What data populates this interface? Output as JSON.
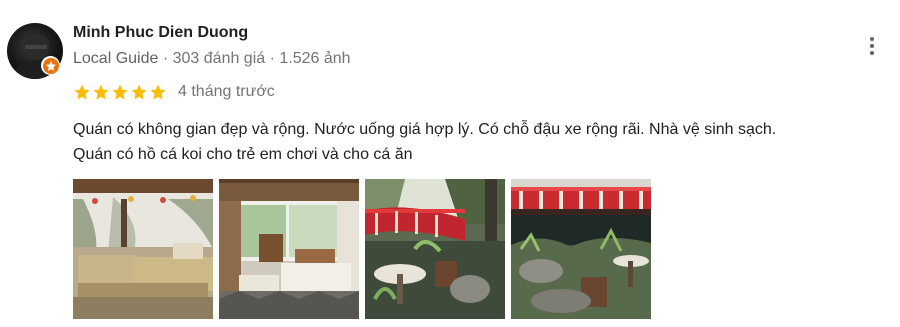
{
  "reviewer": {
    "name": "Minh Phuc Dien Duong",
    "badge": "Local Guide",
    "separator": "·",
    "reviews": "303 đánh giá",
    "photos": "1.526 ảnh",
    "avatar_icon": "profile-photo",
    "badge_icon": "local-guide-star-badge"
  },
  "rating": {
    "stars": 5,
    "max_stars": 5,
    "star_color": "#fbbc04",
    "time": "4 tháng trước"
  },
  "review": {
    "line1": "Quán có không gian đẹp và rộng. Nước uống giá hợp lý. Có chỗ đậu xe rộng rãi. Nhà vệ sinh sạch.",
    "line2": "Quán có hồ cá koi cho trẻ em chơi và cho cá ăn"
  },
  "menu_icon": "more-vert-icon"
}
